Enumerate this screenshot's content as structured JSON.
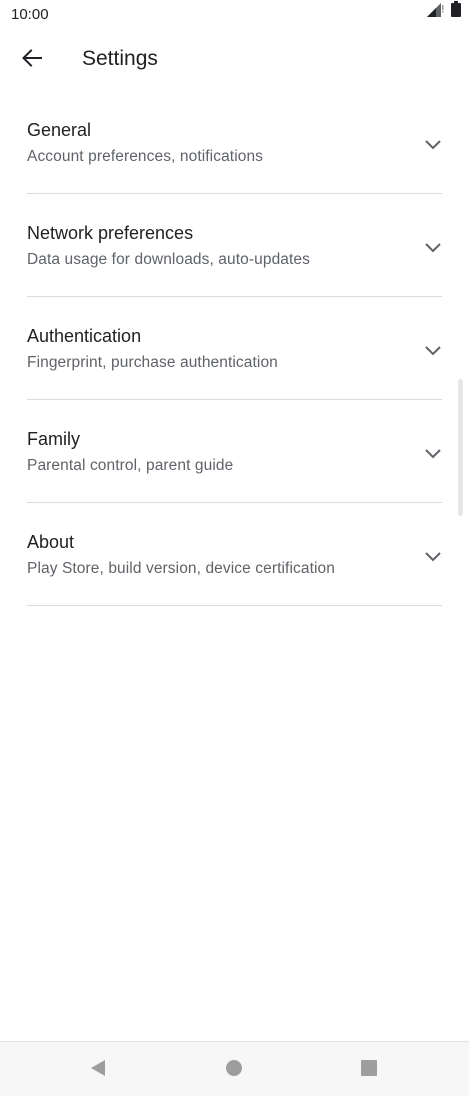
{
  "status_bar": {
    "time": "10:00",
    "icons": [
      "signal-icon",
      "battery-icon"
    ]
  },
  "app_bar": {
    "back_icon": "arrow-back-icon",
    "title": "Settings"
  },
  "settings": {
    "items": [
      {
        "title": "General",
        "subtitle": "Account preferences, notifications"
      },
      {
        "title": "Network preferences",
        "subtitle": "Data usage for downloads, auto-updates"
      },
      {
        "title": "Authentication",
        "subtitle": "Fingerprint, purchase authentication"
      },
      {
        "title": "Family",
        "subtitle": "Parental control, parent guide"
      },
      {
        "title": "About",
        "subtitle": "Play Store, build version, device certification"
      }
    ]
  },
  "nav_bar": {
    "buttons": [
      "back-triangle-icon",
      "home-circle-icon",
      "recents-square-icon"
    ]
  },
  "colors": {
    "text_primary": "#202124",
    "text_secondary": "#5f6368",
    "divider": "#dadce0",
    "nav_icon": "#9e9e9e"
  }
}
